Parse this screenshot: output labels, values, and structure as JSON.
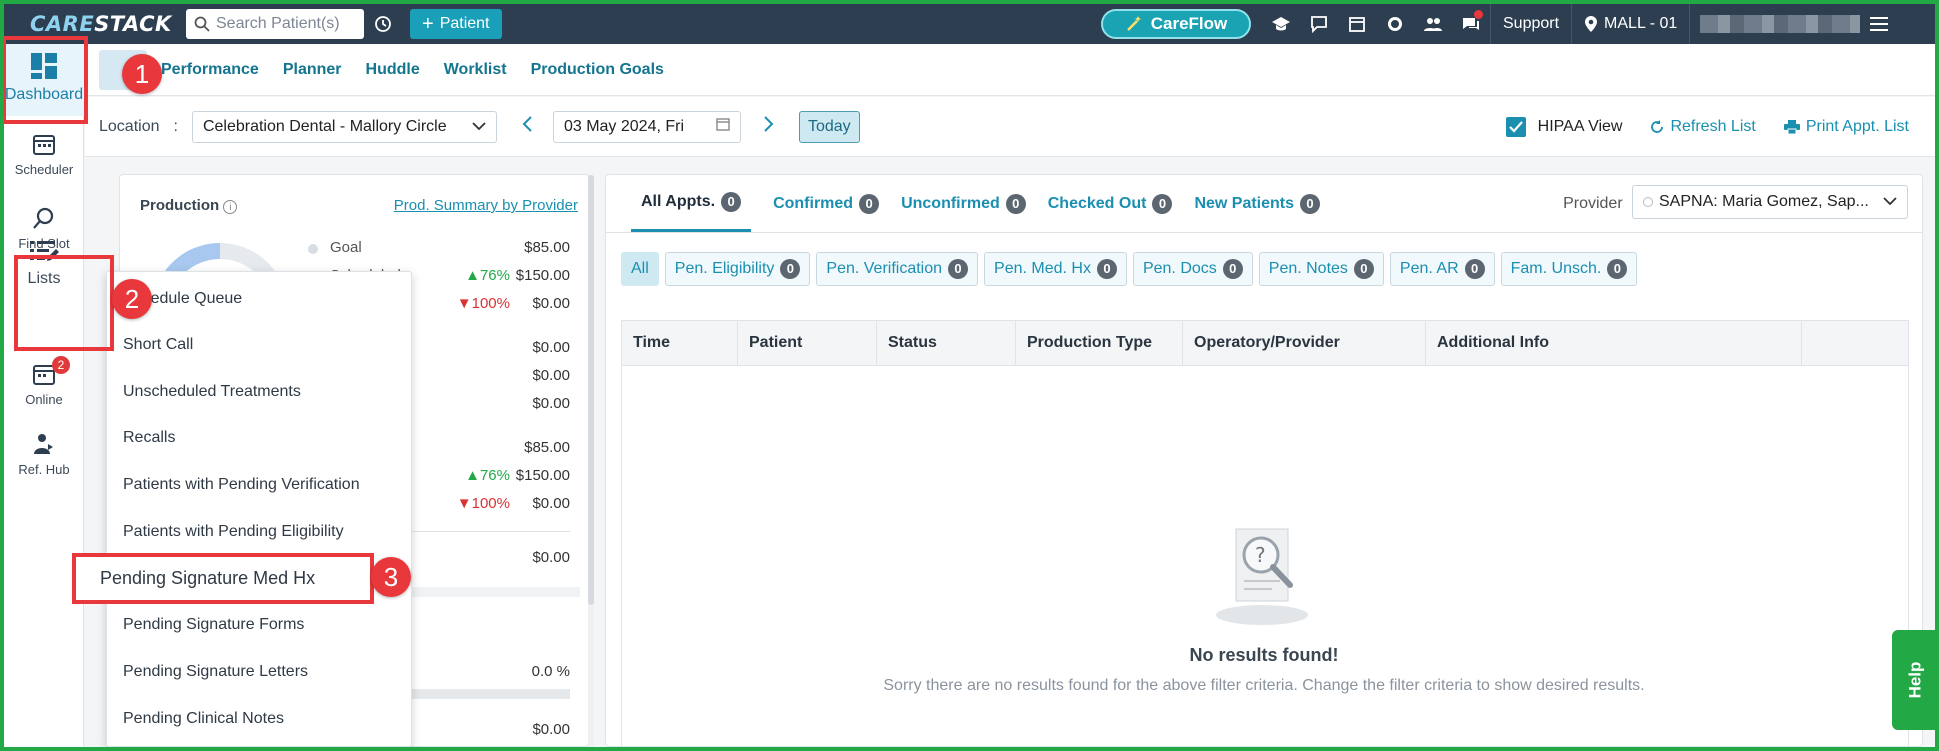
{
  "topbar": {
    "logo_part1": "CARE",
    "logo_part2": "STACK",
    "search_placeholder": "Search Patient(s)",
    "patient_button": "Patient",
    "careflow_button": "CareFlow",
    "support_label": "Support",
    "location_label": "MALL - 01"
  },
  "leftnav": {
    "dashboard": "Dashboard",
    "scheduler": "Scheduler",
    "find_slot": "Find Slot",
    "lists": "Lists",
    "online": "Online",
    "online_badge": "2",
    "ref_hub": "Ref. Hub"
  },
  "subtabs": [
    "Performance",
    "Planner",
    "Huddle",
    "Worklist",
    "Production Goals"
  ],
  "toolbar": {
    "location_label": "Location",
    "location_value": "Celebration Dental - Mallory Circle",
    "date_value": "03 May 2024, Fri",
    "today_button": "Today",
    "hipaa_label": "HIPAA View",
    "refresh_link": "Refresh List",
    "print_link": "Print Appt. List"
  },
  "production": {
    "title": "Production",
    "summary_link": "Prod. Summary by Provider",
    "goal_label": "Goal",
    "goal_value": "$85.00",
    "scheduled_label": "Scheduled",
    "rows": [
      {
        "pct": "76%",
        "dir": "up",
        "value": "$150.00"
      },
      {
        "pct": "100%",
        "dir": "down",
        "value": "$0.00"
      },
      {
        "value": "$0.00"
      },
      {
        "value": "$0.00"
      },
      {
        "value": "$0.00"
      },
      {
        "value": "$85.00"
      },
      {
        "pct": "76%",
        "dir": "up",
        "value": "$150.00"
      },
      {
        "pct": "100%",
        "dir": "down",
        "value": "$0.00"
      },
      {
        "value": "$0.00"
      },
      {
        "value": "0.0 %"
      },
      {
        "value": "$0.00"
      }
    ]
  },
  "lists_menu": [
    "Schedule Queue",
    "Short Call",
    "Unscheduled Treatments",
    "Recalls",
    "Patients with Pending Verification",
    "Patients with Pending Eligibility",
    "Pending Signature Med Hx",
    "Pending Signature Forms",
    "Pending Signature Letters",
    "Pending Clinical Notes"
  ],
  "appointments": {
    "tabs": [
      {
        "label": "All Appts.",
        "count": "0"
      },
      {
        "label": "Confirmed",
        "count": "0"
      },
      {
        "label": "Unconfirmed",
        "count": "0"
      },
      {
        "label": "Checked Out",
        "count": "0"
      },
      {
        "label": "New Patients",
        "count": "0"
      }
    ],
    "provider_label": "Provider",
    "provider_value": "SAPNA: Maria Gomez, Sap...",
    "filters": [
      {
        "label": "All"
      },
      {
        "label": "Pen. Eligibility",
        "count": "0"
      },
      {
        "label": "Pen. Verification",
        "count": "0"
      },
      {
        "label": "Pen. Med. Hx",
        "count": "0"
      },
      {
        "label": "Pen. Docs",
        "count": "0"
      },
      {
        "label": "Pen. Notes",
        "count": "0"
      },
      {
        "label": "Pen. AR",
        "count": "0"
      },
      {
        "label": "Fam. Unsch.",
        "count": "0"
      }
    ],
    "columns": [
      "Time",
      "Patient",
      "Status",
      "Production Type",
      "Operatory/Provider",
      "Additional Info"
    ],
    "empty_title": "No results found!",
    "empty_subtitle": "Sorry there are no results found for the above filter criteria. Change the filter criteria to show desired results."
  },
  "annotations": {
    "step1": "1",
    "step2": "2",
    "step3": "3"
  },
  "help_tab": "Help",
  "colors": {
    "accent": "#1a8fb0",
    "topbar": "#2d3e50",
    "highlight": "#e8383c",
    "frame": "#22a845"
  }
}
